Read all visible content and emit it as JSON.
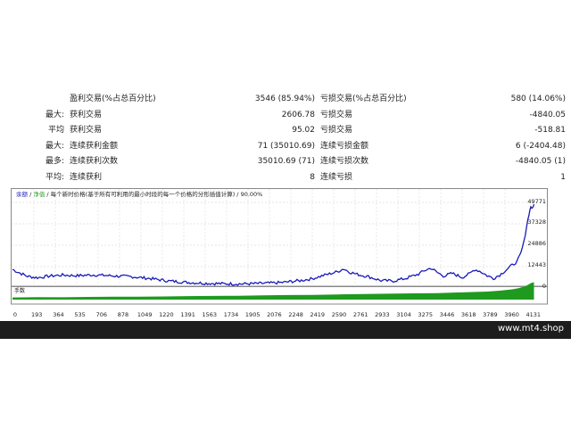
{
  "stats": {
    "rows": [
      {
        "prefix": "",
        "left_label": "盈利交易(%占总百分比)",
        "left_value": "3546 (85.94%)",
        "right_label": "亏损交易(%占总百分比)",
        "right_value": "580 (14.06%)"
      },
      {
        "prefix": "最大:",
        "left_label": "获利交易",
        "left_value": "2606.78",
        "right_label": "亏损交易",
        "right_value": "-4840.05"
      },
      {
        "prefix": "平均",
        "left_label": "获利交易",
        "left_value": "95.02",
        "right_label": "亏损交易",
        "right_value": "-518.81"
      },
      {
        "prefix": "最大:",
        "left_label": "连续获利金额",
        "left_value": "71 (35010.69)",
        "right_label": "连续亏损金额",
        "right_value": "6 (-2404.48)"
      },
      {
        "prefix": "最多:",
        "left_label": "连续获利次数",
        "left_value": "35010.69 (71)",
        "right_label": "连续亏损次数",
        "right_value": "-4840.05 (1)"
      },
      {
        "prefix": "平均:",
        "left_label": "连续获利",
        "left_value": "8",
        "right_label": "连续亏损",
        "right_value": "1"
      }
    ]
  },
  "chart_data": {
    "type": "area",
    "legend": {
      "balance": "余额",
      "equity": "净值",
      "note": "每个新时价格(基于所有可利用的最小时段的每一个价格的分形插值计算)",
      "quality": "90.00%"
    },
    "volume_label": "手数",
    "y_ticks": [
      "49771",
      "37328",
      "24886",
      "12443",
      "0"
    ],
    "x_ticks": [
      "0",
      "193",
      "364",
      "535",
      "706",
      "878",
      "1049",
      "1220",
      "1391",
      "1563",
      "1734",
      "1905",
      "2076",
      "2248",
      "2419",
      "2590",
      "2761",
      "2933",
      "3104",
      "3275",
      "3446",
      "3618",
      "3789",
      "3960",
      "4131"
    ],
    "x_range": [
      0,
      4200
    ],
    "y_range": [
      0,
      52000
    ],
    "balance_points": [
      [
        0,
        10200
      ],
      [
        60,
        8000
      ],
      [
        120,
        6000
      ],
      [
        200,
        5200
      ],
      [
        300,
        6200
      ],
      [
        400,
        6800
      ],
      [
        520,
        6400
      ],
      [
        650,
        6900
      ],
      [
        800,
        6300
      ],
      [
        950,
        5800
      ],
      [
        1100,
        4700
      ],
      [
        1250,
        3200
      ],
      [
        1400,
        2300
      ],
      [
        1550,
        1800
      ],
      [
        1700,
        1500
      ],
      [
        1850,
        1400
      ],
      [
        2000,
        1700
      ],
      [
        2150,
        2200
      ],
      [
        2300,
        3400
      ],
      [
        2400,
        4600
      ],
      [
        2500,
        6800
      ],
      [
        2600,
        8800
      ],
      [
        2650,
        10600
      ],
      [
        2700,
        8600
      ],
      [
        2760,
        7200
      ],
      [
        2850,
        5800
      ],
      [
        2950,
        3400
      ],
      [
        3050,
        3200
      ],
      [
        3150,
        4800
      ],
      [
        3250,
        7400
      ],
      [
        3300,
        9600
      ],
      [
        3350,
        11000
      ],
      [
        3400,
        8400
      ],
      [
        3450,
        6200
      ],
      [
        3520,
        7800
      ],
      [
        3600,
        5400
      ],
      [
        3660,
        7600
      ],
      [
        3700,
        10200
      ],
      [
        3740,
        9200
      ],
      [
        3800,
        6400
      ],
      [
        3850,
        4800
      ],
      [
        3900,
        6800
      ],
      [
        3950,
        9800
      ],
      [
        4000,
        12800
      ],
      [
        4040,
        15000
      ],
      [
        4070,
        20000
      ],
      [
        4095,
        27000
      ],
      [
        4115,
        36000
      ],
      [
        4135,
        44000
      ],
      [
        4150,
        48500
      ],
      [
        4165,
        47000
      ],
      [
        4175,
        49800
      ]
    ],
    "volume_points": [
      [
        0,
        10
      ],
      [
        200,
        12
      ],
      [
        400,
        11
      ],
      [
        600,
        13
      ],
      [
        800,
        14
      ],
      [
        1000,
        15
      ],
      [
        1200,
        16
      ],
      [
        1400,
        18
      ],
      [
        1600,
        19
      ],
      [
        1800,
        20
      ],
      [
        2000,
        22
      ],
      [
        2200,
        24
      ],
      [
        2400,
        25
      ],
      [
        2600,
        28
      ],
      [
        2800,
        30
      ],
      [
        3000,
        32
      ],
      [
        3200,
        34
      ],
      [
        3400,
        36
      ],
      [
        3600,
        40
      ],
      [
        3800,
        45
      ],
      [
        3900,
        50
      ],
      [
        4000,
        58
      ],
      [
        4050,
        65
      ],
      [
        4100,
        75
      ],
      [
        4130,
        85
      ],
      [
        4150,
        95
      ],
      [
        4175,
        100
      ]
    ],
    "colors": {
      "balance": "#1a1ab8",
      "equity": "#2e9e2e",
      "volume": "#1f9a1f",
      "grid": "#c9c9c9"
    }
  },
  "footer": {
    "watermark": "www.mt4.shop"
  }
}
